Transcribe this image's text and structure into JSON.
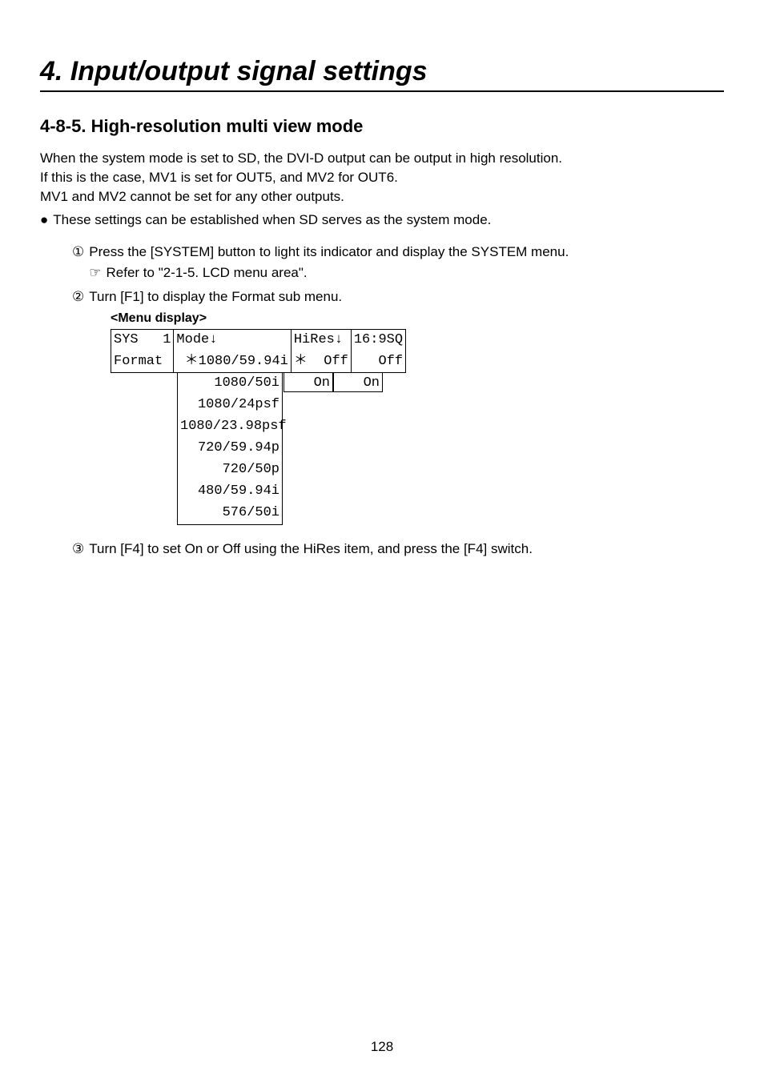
{
  "chapter_title": "4. Input/output signal settings",
  "section_number": "4-8-5.",
  "section_title": "High-resolution multi view mode",
  "intro_lines": [
    "When the system mode is set to SD, the DVI-D output can be output in high resolution.",
    "If this is the case, MV1 is set for OUT5, and MV2 for OUT6.",
    "MV1 and MV2 cannot be set for any other outputs."
  ],
  "bullet1": "These settings can be established when SD serves as the system mode.",
  "step1": "Press the [SYSTEM] button to light its indicator and display the SYSTEM menu.",
  "step1_ref": "Refer to \"2-1-5. LCD menu area\".",
  "step2": "Turn [F1] to display the Format sub menu.",
  "menu_caption": "<Menu display>",
  "menu": {
    "row1": {
      "sys": "SYS   1",
      "mode_hdr": "Mode↓",
      "hires_hdr": "HiRes↓",
      "sq_hdr": "16:9SQ"
    },
    "row2": {
      "format": "Format",
      "mode_val": " ＊1080/59.94i",
      "hires_val": "＊  Off",
      "sq_val": "   Off"
    },
    "mode_options": [
      "    1080/50i",
      "  1080/24psf",
      "1080/23.98psf",
      "  720/59.94p",
      "     720/50p",
      "  480/59.94i",
      "     576/50i"
    ],
    "hires_option": "On",
    "sq_option": "On"
  },
  "step3": "Turn [F4] to set On or Off using the HiRes item, and press the [F4] switch.",
  "page_number": "128"
}
